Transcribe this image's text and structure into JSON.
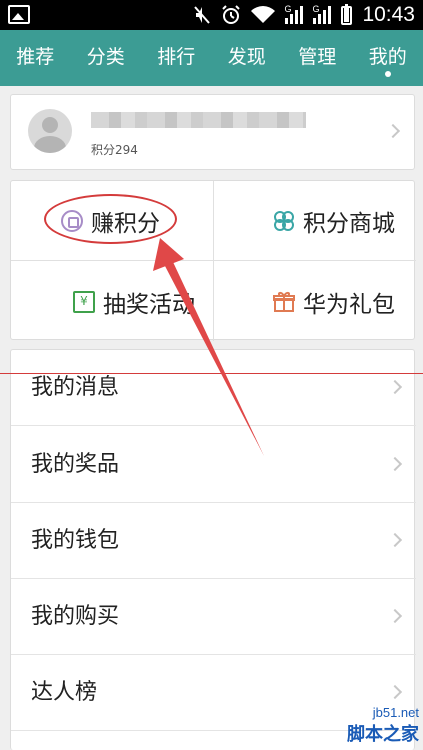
{
  "status_bar": {
    "time": "10:43",
    "icons": [
      "image-icon",
      "mute-icon",
      "alarm-icon",
      "wifi-icon",
      "signal-icon",
      "signal-icon",
      "battery-icon"
    ],
    "network_labels": [
      "G",
      "G"
    ]
  },
  "tabs": [
    {
      "label": "推荐"
    },
    {
      "label": "分类"
    },
    {
      "label": "排行"
    },
    {
      "label": "发现"
    },
    {
      "label": "管理"
    },
    {
      "label": "我的",
      "active": true
    }
  ],
  "profile": {
    "points_label": "积分294"
  },
  "grid": {
    "earn_points": "赚积分",
    "points_mall": "积分商城",
    "lottery": "抽奖活动",
    "huawei_gift": "华为礼包"
  },
  "menu": [
    {
      "label": "我的消息"
    },
    {
      "label": "我的奖品"
    },
    {
      "label": "我的钱包"
    },
    {
      "label": "我的购买"
    },
    {
      "label": "达人榜"
    }
  ],
  "colors": {
    "tab_bar": "#3c9c94",
    "annotation_red": "#d43b3b",
    "earn_icon": "#a78cc7",
    "mall_icon": "#3aa6a6",
    "lottery_icon": "#3fa14b",
    "gift_icon": "#e07a52"
  },
  "watermark": {
    "url": "jb51.net",
    "name": "脚本之家"
  }
}
